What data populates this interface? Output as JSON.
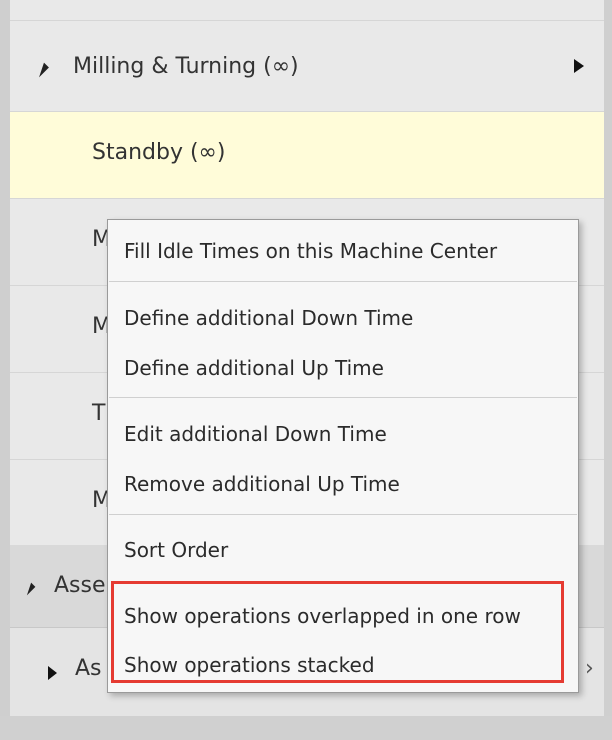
{
  "tree": {
    "group1": {
      "label": "Milling & Turning (∞)"
    },
    "rows": [
      {
        "label": "Standby (∞)",
        "highlighted": true
      },
      {
        "label": "M"
      },
      {
        "label": "M"
      },
      {
        "label": "T"
      },
      {
        "label": "M"
      }
    ],
    "group2": {
      "label": "Asse",
      "sub_label": "As",
      "tail_text": "›"
    }
  },
  "context_menu": {
    "items": [
      {
        "label": "Fill Idle Times on this Machine Center"
      },
      {
        "label": "Define additional Down Time"
      },
      {
        "label": "Define additional Up Time"
      },
      {
        "label": "Edit additional Down Time"
      },
      {
        "label": "Remove additional Up Time"
      },
      {
        "label": "Sort Order"
      },
      {
        "label": "Show operations overlapped in one row"
      },
      {
        "label": "Show operations stacked"
      }
    ]
  },
  "colors": {
    "highlight_row": "#fffcd9",
    "annotation_box": "#e53b32"
  }
}
